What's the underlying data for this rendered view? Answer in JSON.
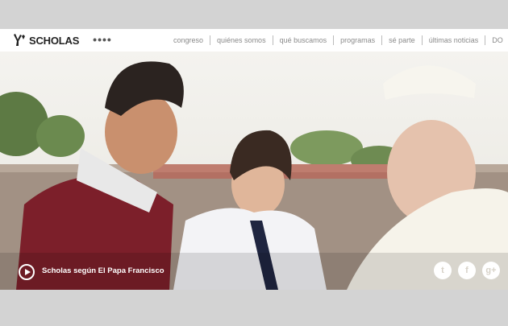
{
  "brand": {
    "name": "SCHOLAS"
  },
  "nav": {
    "more_dots": "••••",
    "items": [
      {
        "label": "congreso"
      },
      {
        "label": "quiénes somos"
      },
      {
        "label": "qué buscamos"
      },
      {
        "label": "programas"
      },
      {
        "label": "sé parte"
      },
      {
        "label": "últimas noticias"
      },
      {
        "label": "DO"
      }
    ]
  },
  "hero": {
    "caption": "Scholas según El Papa Francisco",
    "play_icon": "play-circle-icon"
  },
  "social": [
    {
      "name": "twitter-icon",
      "glyph": "t"
    },
    {
      "name": "facebook-icon",
      "glyph": "f"
    },
    {
      "name": "google-plus-icon",
      "glyph": "g+"
    }
  ],
  "colors": {
    "background": "#d3d3d3",
    "nav_text": "#8a8a8a",
    "caption": "#ffffff"
  }
}
